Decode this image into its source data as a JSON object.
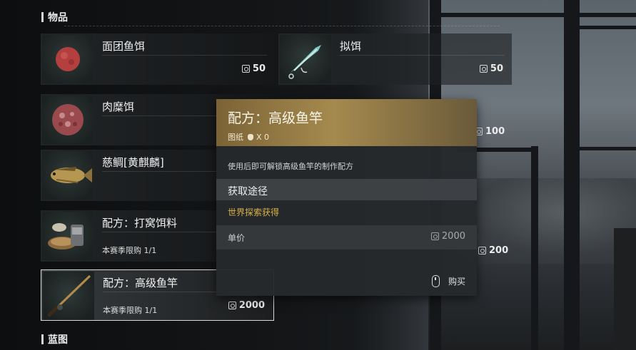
{
  "sections": {
    "items_title": "物品",
    "blueprint_title": "蓝图"
  },
  "items": [
    {
      "name": "面团鱼饵",
      "price": "50",
      "icon": "dough-bait-icon"
    },
    {
      "name": "拟饵",
      "price": "50",
      "icon": "lure-bait-icon"
    },
    {
      "name": "肉糜饵",
      "price": "",
      "icon": "minced-meat-bait-icon"
    },
    {
      "name": "",
      "price": "100",
      "icon": ""
    },
    {
      "name": "慈鲷[黄麒麟]",
      "price": "",
      "icon": "cichlid-fish-icon"
    },
    {
      "name": "配方：打窝饵料",
      "limit": "本赛季限购 1/1",
      "price": "200",
      "icon": "groundbait-recipe-icon"
    },
    {
      "name": "配方：高级鱼竿",
      "limit": "本赛季限购 1/1",
      "price": "2000",
      "icon": "fishing-rod-recipe-icon"
    }
  ],
  "tooltip": {
    "title": "配方：高级鱼竿",
    "category": "图纸",
    "owned": "X 0",
    "description": "使用后即可解锁高级鱼竿的制作配方",
    "acquire_title": "获取途径",
    "acquire_value": "世界探索获得",
    "price_label": "单价",
    "price_value": "2000",
    "buy_label": "购买"
  },
  "colors": {
    "accent_gold": "#a58a4e",
    "acquire_text": "#d8b24a"
  }
}
